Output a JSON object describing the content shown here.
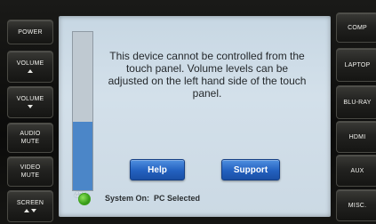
{
  "left_buttons": [
    {
      "label": "POWER"
    },
    {
      "label": "VOLUME",
      "arrow": "up"
    },
    {
      "label": "VOLUME",
      "arrow": "down"
    },
    {
      "label": "AUDIO\nMUTE"
    },
    {
      "label": "VIDEO\nMUTE"
    },
    {
      "label": "SCREEN",
      "arrow": "updown"
    }
  ],
  "right_buttons": [
    {
      "label": "COMP"
    },
    {
      "label": "LAPTOP"
    },
    {
      "label": "BLU-RAY"
    },
    {
      "label": "HDMI"
    },
    {
      "label": "AUX"
    },
    {
      "label": "MISC."
    }
  ],
  "screen": {
    "message": "This device cannot be controlled from the touch panel.  Volume levels can be adjusted on the left hand side of the touch panel.",
    "volume_percent_label": "43%",
    "volume_level": 0.43,
    "help_label": "Help",
    "support_label": "Support",
    "status_label": "System On:",
    "status_value": "PC Selected",
    "status_color": "#3da21c"
  }
}
